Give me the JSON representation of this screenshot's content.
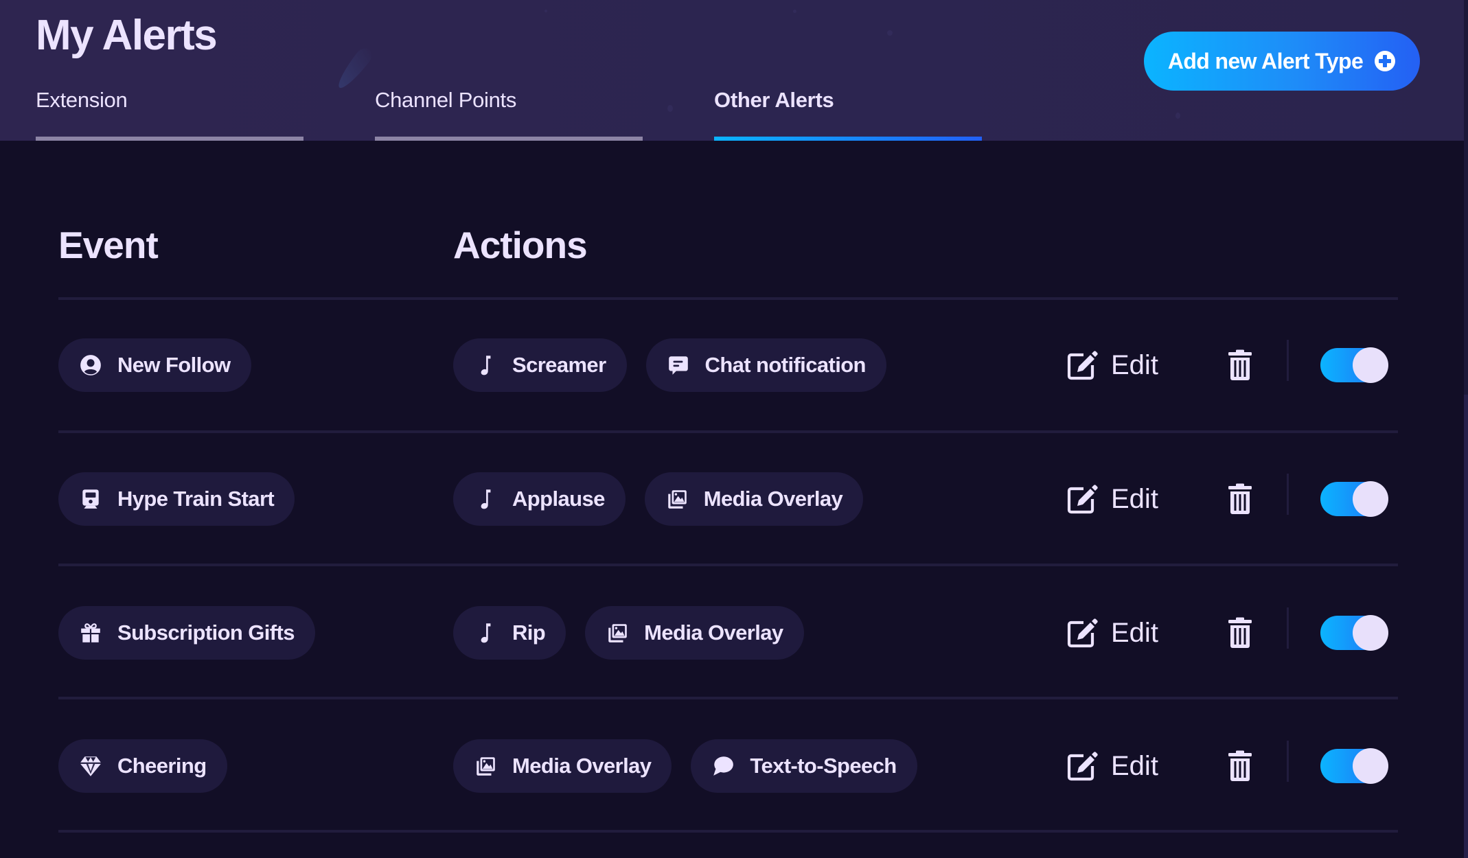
{
  "header": {
    "title": "My Alerts",
    "add_button_label": "Add new Alert Type",
    "add_button_icon": "plus-circle-icon",
    "accent_gradient": [
      "#0bb4ff",
      "#2460f4"
    ]
  },
  "tabs": [
    {
      "label": "Extension",
      "active": false
    },
    {
      "label": "Channel Points",
      "active": false
    },
    {
      "label": "Other Alerts",
      "active": true
    }
  ],
  "table": {
    "columns": {
      "event": "Event",
      "actions": "Actions"
    },
    "edit_label": "Edit",
    "rows": [
      {
        "event": {
          "label": "New Follow",
          "icon": "user-circle-icon"
        },
        "actions": [
          {
            "label": "Screamer",
            "icon": "music-note-icon"
          },
          {
            "label": "Chat notification",
            "icon": "chat-message-icon"
          }
        ],
        "enabled": true
      },
      {
        "event": {
          "label": "Hype Train Start",
          "icon": "train-icon"
        },
        "actions": [
          {
            "label": "Applause",
            "icon": "music-note-icon"
          },
          {
            "label": "Media Overlay",
            "icon": "images-icon"
          }
        ],
        "enabled": true
      },
      {
        "event": {
          "label": "Subscription Gifts",
          "icon": "gift-icon"
        },
        "actions": [
          {
            "label": "Rip",
            "icon": "music-note-icon"
          },
          {
            "label": "Media Overlay",
            "icon": "images-icon"
          }
        ],
        "enabled": true
      },
      {
        "event": {
          "label": "Cheering",
          "icon": "gem-icon"
        },
        "actions": [
          {
            "label": "Media Overlay",
            "icon": "images-icon"
          },
          {
            "label": "Text-to-Speech",
            "icon": "speech-bubble-icon"
          }
        ],
        "enabled": true
      }
    ]
  }
}
